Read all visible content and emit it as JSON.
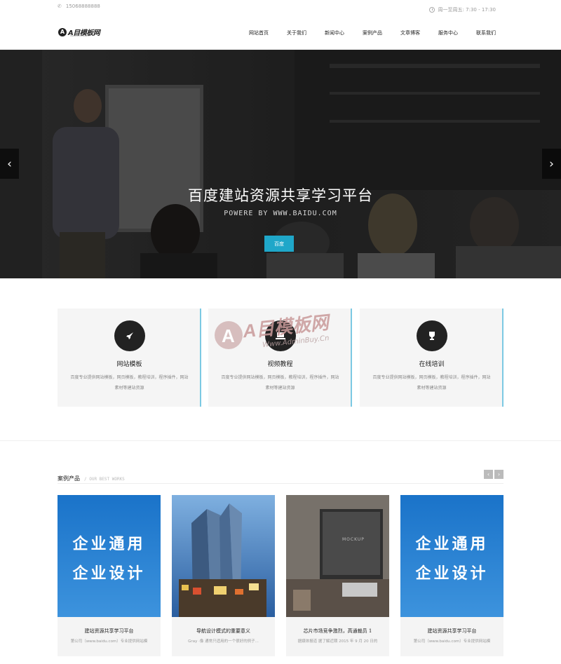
{
  "topbar": {
    "phone": "15068888888",
    "hours": "周一至周五: 7:30 - 17:30"
  },
  "logo": {
    "mark": "A",
    "text": "A目模板网",
    "sub": "Www.AdminBuy.Cn"
  },
  "nav": [
    "网站首页",
    "关于我们",
    "新闻中心",
    "案例产品",
    "文章博客",
    "服务中心",
    "联系我们"
  ],
  "hero": {
    "title": "百度建站资源共享学习平台",
    "subtitle": "POWERE BY WWW.BAIDU.COM",
    "button": "百度",
    "prev": "‹",
    "next": "›"
  },
  "watermark": {
    "text": "A目模板网",
    "sub": "Www.AdminBuy.Cn"
  },
  "services": [
    {
      "icon": "rocket-icon",
      "title": "网站模板",
      "desc": "百度专业提供网站模板，网页模板，教程培训，程序插件，网站素材等建站资源"
    },
    {
      "icon": "laptop-icon",
      "title": "视频教程",
      "desc": "百度专业提供网站模板，网页模板，教程培训，程序插件，网站素材等建站资源"
    },
    {
      "icon": "trophy-icon",
      "title": "在线培训",
      "desc": "百度专业提供网站模板，网页模板，教程培训，程序插件，网站素材等建站资源"
    }
  ],
  "cases": {
    "title": "案例产品",
    "en": "/ OUR BEST WORKS",
    "prev": "‹",
    "next": "›",
    "items": [
      {
        "img_text": [
          "企业通用",
          "企业设计"
        ],
        "title": "建站资源共享学习平台",
        "desc": "第公司（www.baidu.com）专业提供网站模"
      },
      {
        "img_text": [],
        "title": "导航设计模式的重要意义",
        "desc": "Gray ·像 通常只适用的一个很好的例子..."
      },
      {
        "img_text": [
          "MOCKUP"
        ],
        "title": "芯片市场竞争激烈，高通裁员 1",
        "desc": "据媒体报道 据了解近期 2015 年 9 月 20 日的"
      },
      {
        "img_text": [
          "企业通用",
          "企业设计"
        ],
        "title": "建站资源共享学习平台",
        "desc": "第公司（www.baidu.com）专业提供网站模"
      }
    ]
  }
}
